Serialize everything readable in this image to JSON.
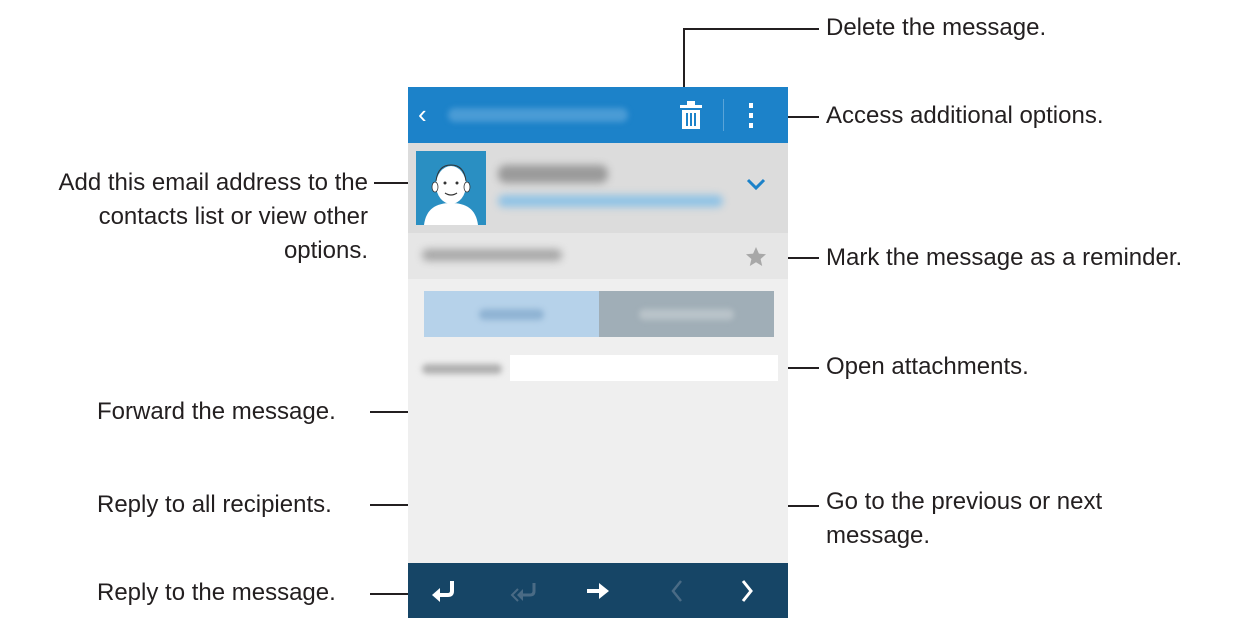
{
  "callouts": {
    "delete": "Delete the message.",
    "options": "Access additional options.",
    "add_contact_line1": "Add this email address to the",
    "add_contact_line2": "contacts list or view other",
    "add_contact_line3": "options.",
    "reminder": "Mark the message as a reminder.",
    "attachments": "Open attachments.",
    "forward": "Forward the message.",
    "reply_all": "Reply to all recipients.",
    "reply": "Reply to the message.",
    "prev_next_line1": "Go to the previous or next",
    "prev_next_line2": "message."
  },
  "icons": {
    "back": "back-arrow-icon",
    "delete": "trash-icon",
    "more": "kebab-menu-icon",
    "expand": "chevron-down-icon",
    "star": "star-icon",
    "reply": "reply-icon",
    "reply_all": "reply-all-icon",
    "forward": "forward-icon",
    "previous": "chevron-left-icon",
    "next": "chevron-right-icon"
  },
  "colors": {
    "topbar": "#1c82c9",
    "bottombar": "#164566",
    "tab_message": "#b6d2ea",
    "tab_attachment": "#a0aeb7"
  }
}
